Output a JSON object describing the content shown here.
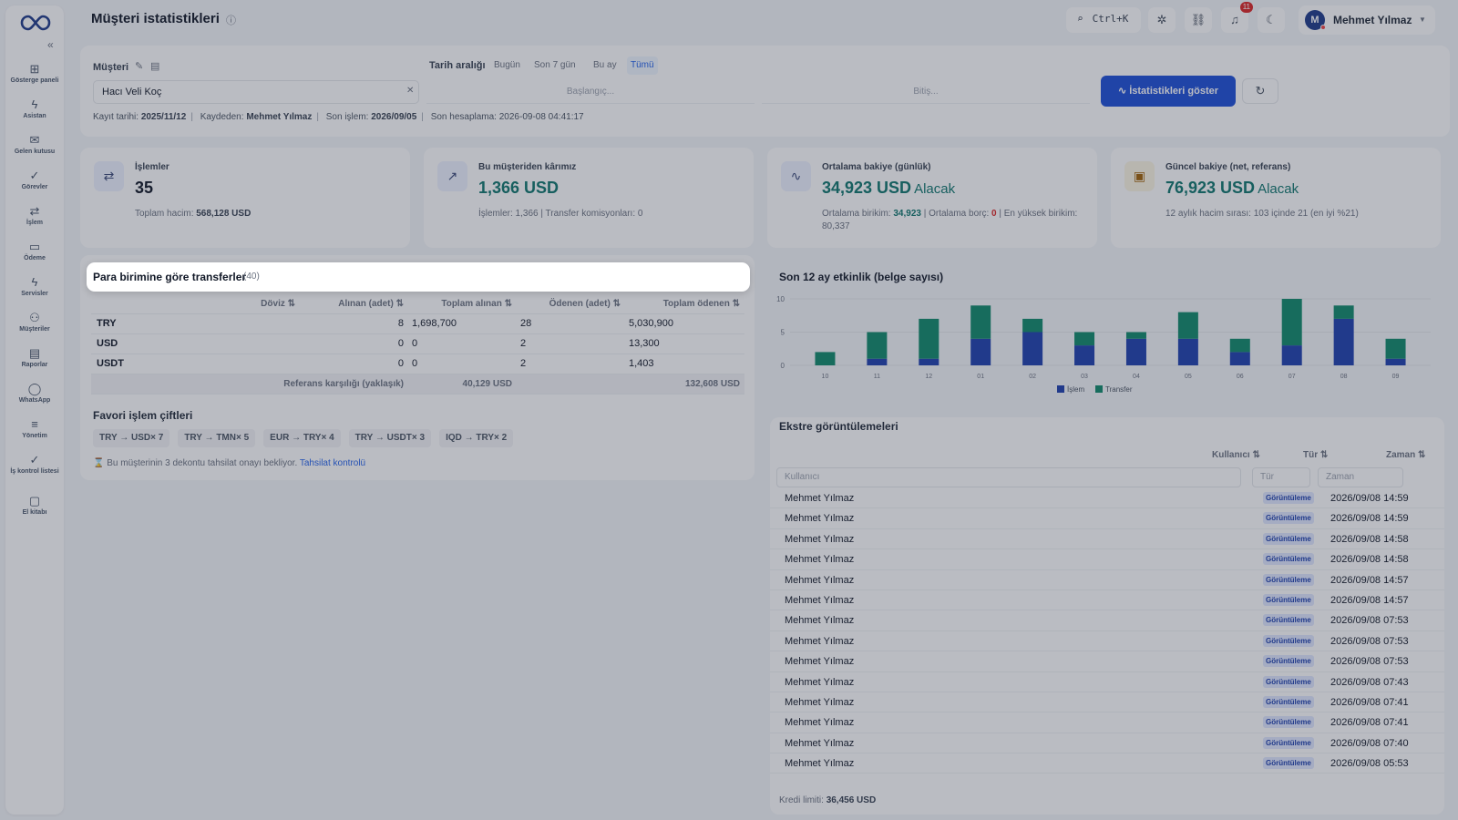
{
  "sidebar": {
    "items": [
      {
        "label": "Gösterge paneli",
        "icon": "grid-icon"
      },
      {
        "label": "Asistan",
        "icon": "lightning-icon"
      },
      {
        "label": "Gelen kutusu",
        "icon": "inbox-icon"
      },
      {
        "label": "Görevler",
        "icon": "check-icon"
      },
      {
        "label": "İşlem",
        "icon": "transfer-icon"
      },
      {
        "label": "Ödeme",
        "icon": "payment-icon"
      },
      {
        "label": "Servisler",
        "icon": "bolt-icon"
      },
      {
        "label": "Müşteriler",
        "icon": "users-icon"
      },
      {
        "label": "Raporlar",
        "icon": "report-icon"
      },
      {
        "label": "WhatsApp",
        "icon": "chat-icon"
      },
      {
        "label": "Yönetim",
        "icon": "sliders-icon"
      },
      {
        "label": "İş kontrol listesi",
        "icon": "checklist-icon"
      },
      {
        "label": "El kitabı",
        "icon": "book-icon"
      }
    ]
  },
  "header": {
    "title": "Müşteri istatistikleri",
    "search_shortcut": "Ctrl+K",
    "notification_count": "11",
    "user_initial": "M",
    "user_name": "Mehmet Yılmaz"
  },
  "filter": {
    "customer_label": "Müşteri",
    "customer_value": "Hacı Veli Koç",
    "date_range_label": "Tarih aralığı",
    "ranges": [
      "Bugün",
      "Son 7 gün",
      "Bu ay",
      "Tümü"
    ],
    "active_range": "Tümü",
    "start_placeholder": "Başlangıç...",
    "end_placeholder": "Bitiş...",
    "show_button": "İstatistikleri göster",
    "meta": {
      "reg_label": "Kayıt tarihi:",
      "reg_value": "2025/11/12",
      "by_label": "Kaydeden:",
      "by_value": "Mehmet Yılmaz",
      "last_label": "Son işlem:",
      "last_value": "2026/09/05",
      "calc_label": "Son hesaplama:",
      "calc_value": "2026-09-08 04:41:17"
    }
  },
  "kpis": [
    {
      "title": "İşlemler",
      "value": "35",
      "suffix": "",
      "sub_label": "Toplam hacim:",
      "sub_value": "568,128 USD",
      "icon": "transfer-icon"
    },
    {
      "title": "Bu müşteriden kârımız",
      "value": "1,366 USD",
      "suffix": "",
      "sub": "İşlemler: 1,366 | Transfer komisyonları: 0",
      "icon": "trend-up-icon"
    },
    {
      "title": "Ortalama bakiye (günlük)",
      "value": "34,923 USD",
      "suffix": "Alacak",
      "sub_a": "Ortalama birikim:",
      "sub_a_val": "34,923",
      "sub_b": "Ortalama borç:",
      "sub_b_val": "0",
      "sub_c": "En yüksek birikim: 80,337",
      "icon": "pulse-icon"
    },
    {
      "title": "Güncel bakiye (net, referans)",
      "value": "76,923 USD",
      "suffix": "Alacak",
      "sub": "12 aylık hacim sırası: 103 içinde 21 (en iyi %21)",
      "icon": "wallet-icon"
    }
  ],
  "transfers": {
    "title": "Para birimine göre transferler",
    "count": "(40)",
    "columns": [
      "Döviz ⇅",
      "Alınan (adet) ⇅",
      "Toplam alınan ⇅",
      "Ödenen (adet) ⇅",
      "Toplam ödenen ⇅"
    ],
    "rows": [
      {
        "cur": "TRY",
        "rc": "8",
        "rt": "1,698,700",
        "pc": "28",
        "pt": "5,030,900"
      },
      {
        "cur": "USD",
        "rc": "0",
        "rt": "0",
        "pc": "2",
        "pt": "13,300"
      },
      {
        "cur": "USDT",
        "rc": "0",
        "rt": "0",
        "pc": "2",
        "pt": "1,403"
      }
    ],
    "ref_label": "Referans karşılığı (yaklaşık)",
    "ref_received": "40,129 USD",
    "ref_paid": "132,608 USD"
  },
  "favorites": {
    "title": "Favori işlem çiftleri",
    "pairs": [
      "TRY → USD× 7",
      "TRY → TMN× 5",
      "EUR → TRY× 4",
      "TRY → USDT× 3",
      "IQD → TRY× 2"
    ],
    "pending_text": "Bu müşterinin 3 dekontu tahsilat onayı bekliyor.",
    "pending_link": "Tahsilat kontrolü"
  },
  "chart_data": {
    "type": "bar",
    "stacked": true,
    "title": "Son 12 ay etkinlik (belge sayısı)",
    "categories": [
      "10",
      "11",
      "12",
      "01",
      "02",
      "03",
      "04",
      "05",
      "06",
      "07",
      "08",
      "09"
    ],
    "ylim": [
      0,
      10
    ],
    "yticks": [
      "0",
      "5",
      "10"
    ],
    "grid": true,
    "legend": "bottom",
    "series": [
      {
        "name": "İşlem",
        "color": "#1e40af",
        "values": [
          0,
          1,
          1,
          4,
          5,
          3,
          4,
          4,
          2,
          3,
          7,
          1
        ]
      },
      {
        "name": "Transfer",
        "color": "#0f8a6a",
        "values": [
          2,
          4,
          6,
          5,
          2,
          2,
          1,
          4,
          2,
          7,
          2,
          3
        ]
      }
    ]
  },
  "statements": {
    "title": "Ekstre görüntülemeleri",
    "col_user": "Kullanıcı ⇅",
    "col_type": "Tür ⇅",
    "col_time": "Zaman ⇅",
    "ph_user": "Kullanıcı",
    "ph_type": "Tür",
    "ph_time": "Zaman",
    "rows": [
      {
        "user": "Mehmet Yılmaz",
        "type": "Görüntüleme",
        "time": "2026/09/08 14:59"
      },
      {
        "user": "Mehmet Yılmaz",
        "type": "Görüntüleme",
        "time": "2026/09/08 14:59"
      },
      {
        "user": "Mehmet Yılmaz",
        "type": "Görüntüleme",
        "time": "2026/09/08 14:58"
      },
      {
        "user": "Mehmet Yılmaz",
        "type": "Görüntüleme",
        "time": "2026/09/08 14:58"
      },
      {
        "user": "Mehmet Yılmaz",
        "type": "Görüntüleme",
        "time": "2026/09/08 14:57"
      },
      {
        "user": "Mehmet Yılmaz",
        "type": "Görüntüleme",
        "time": "2026/09/08 14:57"
      },
      {
        "user": "Mehmet Yılmaz",
        "type": "Görüntüleme",
        "time": "2026/09/08 07:53"
      },
      {
        "user": "Mehmet Yılmaz",
        "type": "Görüntüleme",
        "time": "2026/09/08 07:53"
      },
      {
        "user": "Mehmet Yılmaz",
        "type": "Görüntüleme",
        "time": "2026/09/08 07:53"
      },
      {
        "user": "Mehmet Yılmaz",
        "type": "Görüntüleme",
        "time": "2026/09/08 07:43"
      },
      {
        "user": "Mehmet Yılmaz",
        "type": "Görüntüleme",
        "time": "2026/09/08 07:41"
      },
      {
        "user": "Mehmet Yılmaz",
        "type": "Görüntüleme",
        "time": "2026/09/08 07:41"
      },
      {
        "user": "Mehmet Yılmaz",
        "type": "Görüntüleme",
        "time": "2026/09/08 07:40"
      },
      {
        "user": "Mehmet Yılmaz",
        "type": "Görüntüleme",
        "time": "2026/09/08 05:53"
      }
    ],
    "credit_label": "Kredi limiti:",
    "credit_value": "36,456 USD"
  }
}
